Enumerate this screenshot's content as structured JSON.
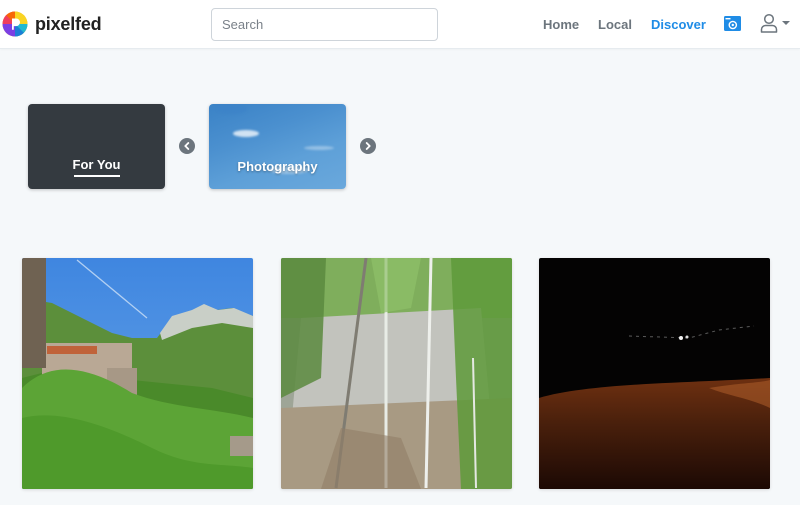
{
  "header": {
    "brand_name": "pixelfed",
    "search_placeholder": "Search",
    "search_value": "",
    "nav": [
      {
        "label": "Home",
        "active": false
      },
      {
        "label": "Local",
        "active": false
      },
      {
        "label": "Discover",
        "active": true
      }
    ],
    "icons": {
      "compose": "camera-icon",
      "user": "user-icon",
      "user_menu_caret": "caret-down-icon"
    },
    "accent_color": "#1f8ce6"
  },
  "categories": {
    "cards": [
      {
        "label": "For You",
        "selected": true,
        "background": "#343a40"
      },
      {
        "label": "Photography",
        "selected": false,
        "background": "sky-image"
      }
    ],
    "prev_icon": "chevron-left-icon",
    "next_icon": "chevron-right-icon"
  },
  "posts": [
    {
      "description": "Hillside village with green trees and mountain peaks under blue sky"
    },
    {
      "description": "Birch trees in front of a rocky cliff in a forest"
    },
    {
      "description": "Night scene with distant lights and orange-lit ground"
    }
  ]
}
